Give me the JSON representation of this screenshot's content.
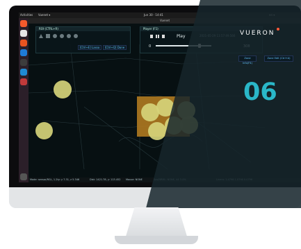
{
  "topbar": {
    "activities": "Activities",
    "app": "Vuenet ▾",
    "time": "Jun 30 · 14:41",
    "right": "en ▾"
  },
  "window": {
    "title": "Vuenet"
  },
  "roi_panel": {
    "title": "ROI (CTRL+R)",
    "btn1": "[Ctrl+E] Lasso",
    "btn2": "[Ctrl+Q] Done"
  },
  "player_panel": {
    "title": "Player (F1)",
    "play_label": "Play",
    "timestamp": "2021-05-29 11:57:49.566",
    "start": "0",
    "end": "308",
    "progress": 0.8
  },
  "overlay": {
    "logo": "VUERON",
    "big_number": "06",
    "zone_info": "Zone Info(F4)",
    "zone_edit": "Zone Edit (Ctrl+A)"
  },
  "status": {
    "left": "Mode: sensor/RGL, 1.2ty: y 7.31, z 5.346",
    "mid1": "Dist: 1421.78, y: 113.452",
    "mid2": "Mouse: NONE",
    "mid3": "Sos/NRML: NONE, 44 3.4%",
    "right": "Linera: 1.4796 1.0796 0.0796"
  },
  "colors": {
    "accent": "#2ab7c8",
    "logo_dot": "#ff5a3a",
    "circle": "#d5d37a",
    "box": "#b07a20"
  }
}
